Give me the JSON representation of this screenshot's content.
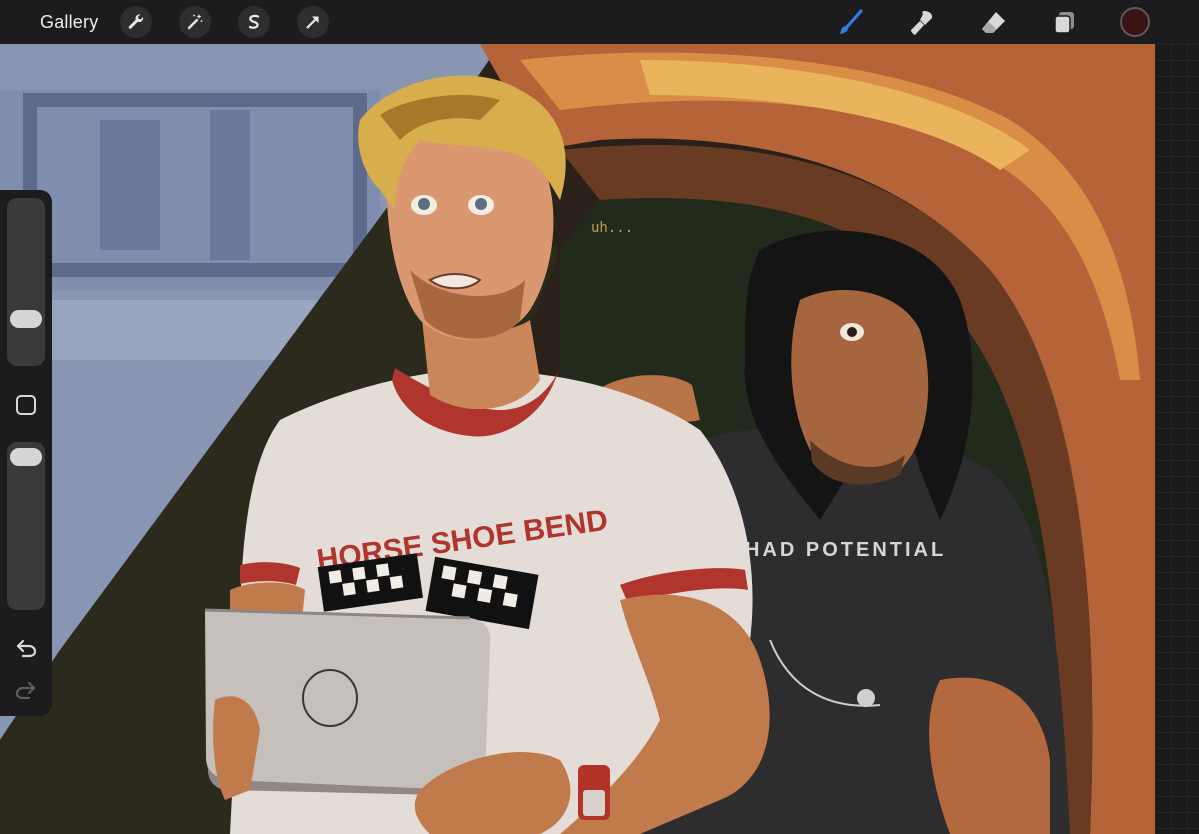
{
  "topbar": {
    "gallery_label": "Gallery",
    "left_tools": [
      "wrench-icon",
      "magic-wand-icon",
      "selection-icon",
      "transform-arrow-icon"
    ],
    "right_tools": [
      "brush-icon",
      "smudge-icon",
      "eraser-icon",
      "layers-icon"
    ],
    "active_tool": "brush",
    "current_color": "#3a1414",
    "accent": "#2f7fe0"
  },
  "sidebar": {
    "brush_size_level": 0.35,
    "opacity_level": 0.9,
    "modify_button": "square-icon",
    "undo": "undo-icon",
    "redo": "redo-icon"
  },
  "canvas": {
    "speech_text": "uh...",
    "shirt_text": "HORSE SHOE BEND",
    "back_shirt_text": "HAD POTENTIAL"
  }
}
